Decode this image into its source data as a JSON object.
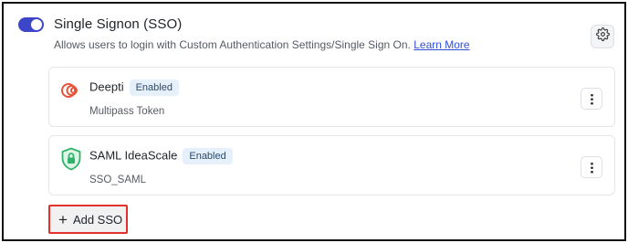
{
  "header": {
    "toggle_on": true,
    "title": "Single Signon (SSO)",
    "description": "Allows users to login with Custom Authentication Settings/Single Sign On.",
    "learn_more": "Learn More",
    "settings_icon": "gear-icon"
  },
  "sso_list": [
    {
      "name": "Deepti",
      "status": "Enabled",
      "type": "Multipass Token",
      "icon": "multipass-logo-icon",
      "icon_color": "#e8533a"
    },
    {
      "name": "SAML IdeaScale",
      "status": "Enabled",
      "type": "SSO_SAML",
      "icon": "shield-lock-icon",
      "icon_color": "#2fb36a"
    }
  ],
  "add_button": {
    "icon": "plus-icon",
    "label": "Add SSO"
  },
  "colors": {
    "toggle": "#3d46c9",
    "link": "#2f4fd6",
    "badge_bg": "#e6f0fa",
    "highlight_border": "#e0312b"
  }
}
